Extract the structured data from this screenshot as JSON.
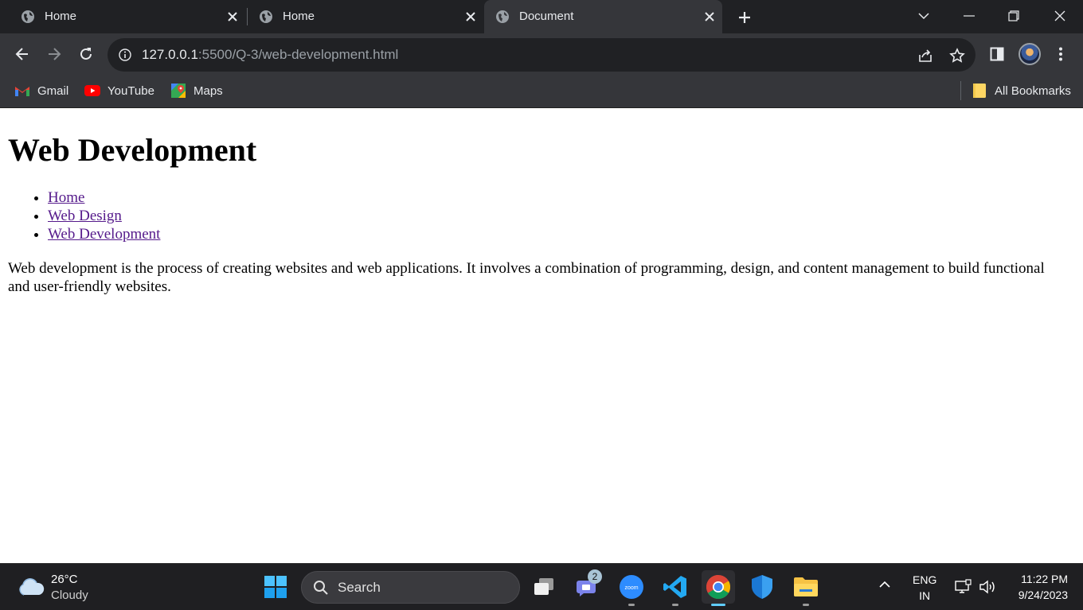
{
  "tabs": [
    {
      "title": "Home",
      "active": false
    },
    {
      "title": "Home",
      "active": false
    },
    {
      "title": "Document",
      "active": true
    }
  ],
  "address_bar": {
    "url_host": "127.0.0.1",
    "url_rest": ":5500/Q-3/web-development.html"
  },
  "bookmarks": [
    {
      "label": "Gmail",
      "icon": "gmail-icon"
    },
    {
      "label": "YouTube",
      "icon": "youtube-icon"
    },
    {
      "label": "Maps",
      "icon": "maps-icon"
    }
  ],
  "all_bookmarks": {
    "label": "All Bookmarks",
    "icon": "folder-icon"
  },
  "page": {
    "heading": "Web Development",
    "nav_links": [
      "Home",
      "Web Design",
      "Web Development"
    ],
    "paragraph": "Web development is the process of creating websites and web applications. It involves a combination of programming, design, and content management to build functional and user-friendly websites."
  },
  "taskbar": {
    "weather": {
      "temp": "26°C",
      "condition": "Cloudy"
    },
    "search_label": "Search",
    "teams_badge": "2",
    "language": {
      "line1": "ENG",
      "line2": "IN"
    },
    "clock": {
      "time": "11:22 PM",
      "date": "9/24/2023"
    }
  },
  "colors": {
    "tab_strip": "#202124",
    "toolbar": "#35363a",
    "link_visited": "#551a8b",
    "taskbar": "#1f1f22",
    "taskbar_active_indicator": "#60cdff"
  }
}
